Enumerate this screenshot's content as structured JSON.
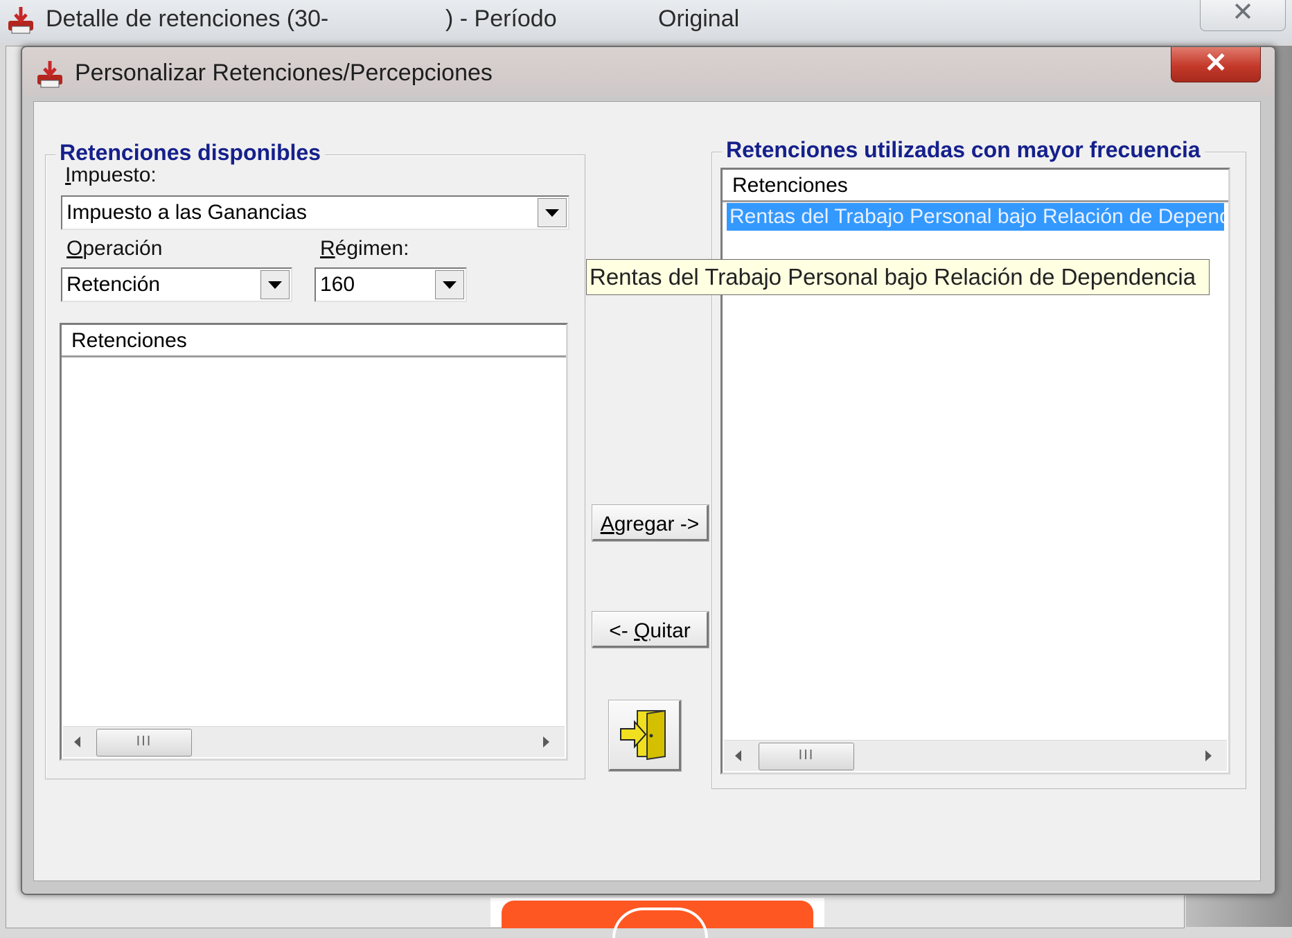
{
  "colors": {
    "legend": "#15208c",
    "selection": "#3399ff",
    "tooltip_bg": "#ffffe1",
    "close_red": "#c4392a"
  },
  "outer_window": {
    "icon": "printer-download-icon",
    "title_part1": "Detalle de retenciones (30-",
    "title_part2": ") - Período",
    "title_part3": "Original",
    "close_glyph": "✕"
  },
  "dialog": {
    "icon": "printer-download-icon",
    "title": "Personalizar Retenciones/Percepciones",
    "close_glyph": "✕"
  },
  "available": {
    "legend": "Retenciones disponibles",
    "impuesto_label_u": "I",
    "impuesto_label_rest": "mpuesto:",
    "impuesto_value": "Impuesto a las Ganancias",
    "operacion_label_u": "O",
    "operacion_label_rest": "peración",
    "operacion_value": "Retención",
    "regimen_label_u": "R",
    "regimen_label_rest": "égimen:",
    "regimen_value": "160",
    "list_header": "Retenciones",
    "scroll_grip": "III"
  },
  "frequent": {
    "legend": "Retenciones utilizadas con mayor frecuencia",
    "list_header": "Retenciones",
    "items": [
      "Rentas del Trabajo Personal bajo Relación de Dependencia"
    ],
    "scroll_grip": "III"
  },
  "tooltip": {
    "text": "Rentas del Trabajo Personal bajo Relación de Dependencia"
  },
  "buttons": {
    "agregar_u": "A",
    "agregar_rest": "gregar ->",
    "quitar_prefix": "<- ",
    "quitar_u": "Q",
    "quitar_rest": "uitar",
    "exit_icon": "exit-door-icon"
  }
}
